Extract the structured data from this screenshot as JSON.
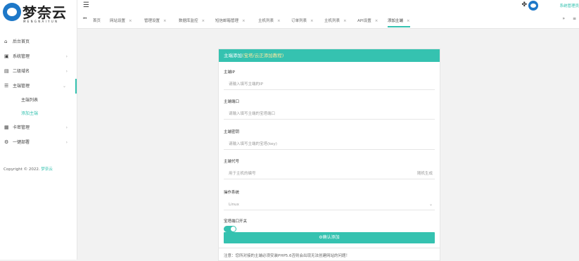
{
  "brand": {
    "name": "梦奈云",
    "subtitle": "MENGNAIYUN"
  },
  "sidebar": {
    "items": [
      {
        "icon": "home-icon",
        "glyph": "⌂",
        "label": "后台首页"
      },
      {
        "icon": "system-icon",
        "glyph": "▣",
        "label": "系统管理"
      },
      {
        "icon": "card-icon",
        "glyph": "▤",
        "label": "二级域名"
      },
      {
        "icon": "list-icon",
        "glyph": "☰",
        "label": "主端管理"
      },
      {
        "icon": "grid-icon",
        "glyph": "▦",
        "label": "卡密管理"
      },
      {
        "icon": "settings-icon",
        "glyph": "⚙",
        "label": "一键部署"
      }
    ],
    "subitems": [
      "主端列表",
      "添加主端"
    ]
  },
  "copyright": {
    "text": "Copyright © 2022.",
    "brand": "梦奈云"
  },
  "header": {
    "tabs": [
      "首页",
      "网站设置",
      "管理设置",
      "数据库监控",
      "短信邮箱管理",
      "主机列表",
      "订单列表",
      "主机列表",
      "API设置",
      "添加主端"
    ],
    "nav_prev": "⏮",
    "nav_next": "»",
    "user_name": "系统管理员"
  },
  "form": {
    "title": "主端添加",
    "title_hint": "(宝塔/云正添加教程)",
    "fields": [
      {
        "label": "主端IP",
        "placeholder": "请输入填写主端的IP"
      },
      {
        "label": "主端端口",
        "placeholder": "请输入填写主端的宝塔端口"
      },
      {
        "label": "主端密钥",
        "placeholder": "请输入填写主端的宝塔(key)"
      },
      {
        "label": "主端代号",
        "placeholder": "用于主机的编号",
        "suffix": "随机生成"
      }
    ],
    "os": {
      "label": "操作系统",
      "value": "Linux"
    },
    "port_switch": {
      "label": "宝塔端口开关",
      "enabled": true
    },
    "submit": "⚙确认添加",
    "note": "注意：您所对接的主端必须安装PHP5.6否则会出现无法创建网站的问题！"
  }
}
